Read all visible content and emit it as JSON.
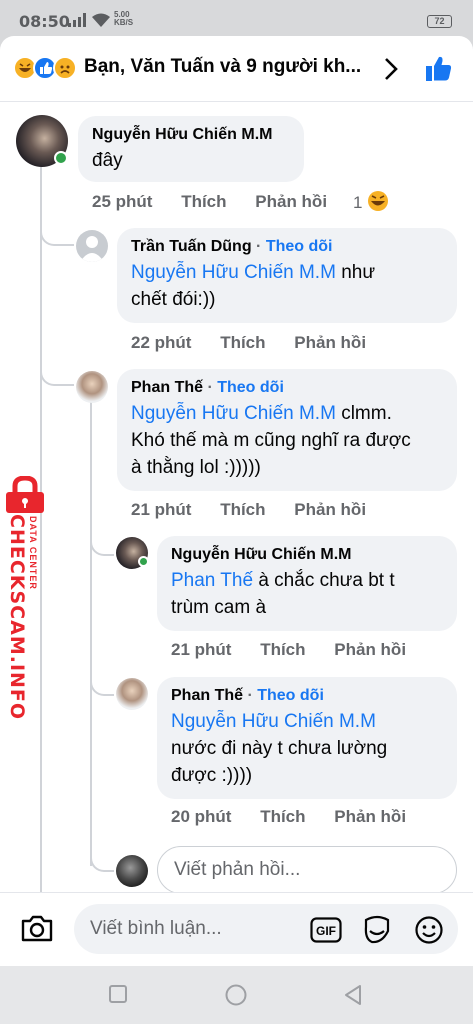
{
  "status_bar": {
    "time": "08:50",
    "net_speed_value": "5.00",
    "net_speed_unit": "KB/S",
    "battery": "72"
  },
  "header": {
    "title": "Bạn, Văn Tuấn và 9 người kh..."
  },
  "comments": [
    {
      "author": "Nguyễn Hữu Chiến M.M",
      "text": "đây",
      "time": "25 phút",
      "like": "Thích",
      "reply": "Phản hồi",
      "reaction_count": "1"
    },
    {
      "author": "Trần Tuấn Dũng",
      "follow": "Theo dõi",
      "mention": "Nguyễn Hữu Chiến M.M",
      "text_line1": " như",
      "text_line2": "chết đói:))",
      "time": "22 phút",
      "like": "Thích",
      "reply": "Phản hồi"
    },
    {
      "author": "Phan Thế",
      "follow": "Theo dõi",
      "mention": "Nguyễn Hữu Chiến M.M",
      "text_line1": " clmm.",
      "text_line2": "Khó thế mà m cũng nghĩ ra được",
      "text_line3": "à thằng lol :)))))",
      "time": "21 phút",
      "like": "Thích",
      "reply": "Phản hồi"
    },
    {
      "author": "Nguyễn Hữu Chiến M.M",
      "mention": "Phan Thế",
      "text_line1": " à chắc chưa bt t",
      "text_line2": "trùm cam à",
      "time": "21 phút",
      "like": "Thích",
      "reply": "Phản hồi"
    },
    {
      "author": "Phan Thế",
      "follow": "Theo dõi",
      "mention": "Nguyễn Hữu Chiến M.M",
      "text_line2": "nước đi này t chưa lường",
      "text_line3": "được :))))",
      "time": "20 phút",
      "like": "Thích",
      "reply": "Phản hồi"
    }
  ],
  "reply_input": {
    "placeholder": "Viết phản hồi..."
  },
  "composer": {
    "placeholder": "Viết bình luận...",
    "gif_label": "GIF"
  },
  "watermark": {
    "brand": "CHECKSCAM.INFO",
    "tag": "DATA CENTER"
  },
  "colors": {
    "accent": "#1877f2",
    "online": "#31a24c",
    "watermark": "#e8262d"
  },
  "icons": [
    "haha-icon",
    "like-icon",
    "sad-icon",
    "chevron-right-icon",
    "thumbs-up-icon",
    "camera-icon",
    "gif-icon",
    "sticker-icon",
    "emoji-icon",
    "square-nav-icon",
    "circle-nav-icon",
    "back-nav-icon"
  ]
}
